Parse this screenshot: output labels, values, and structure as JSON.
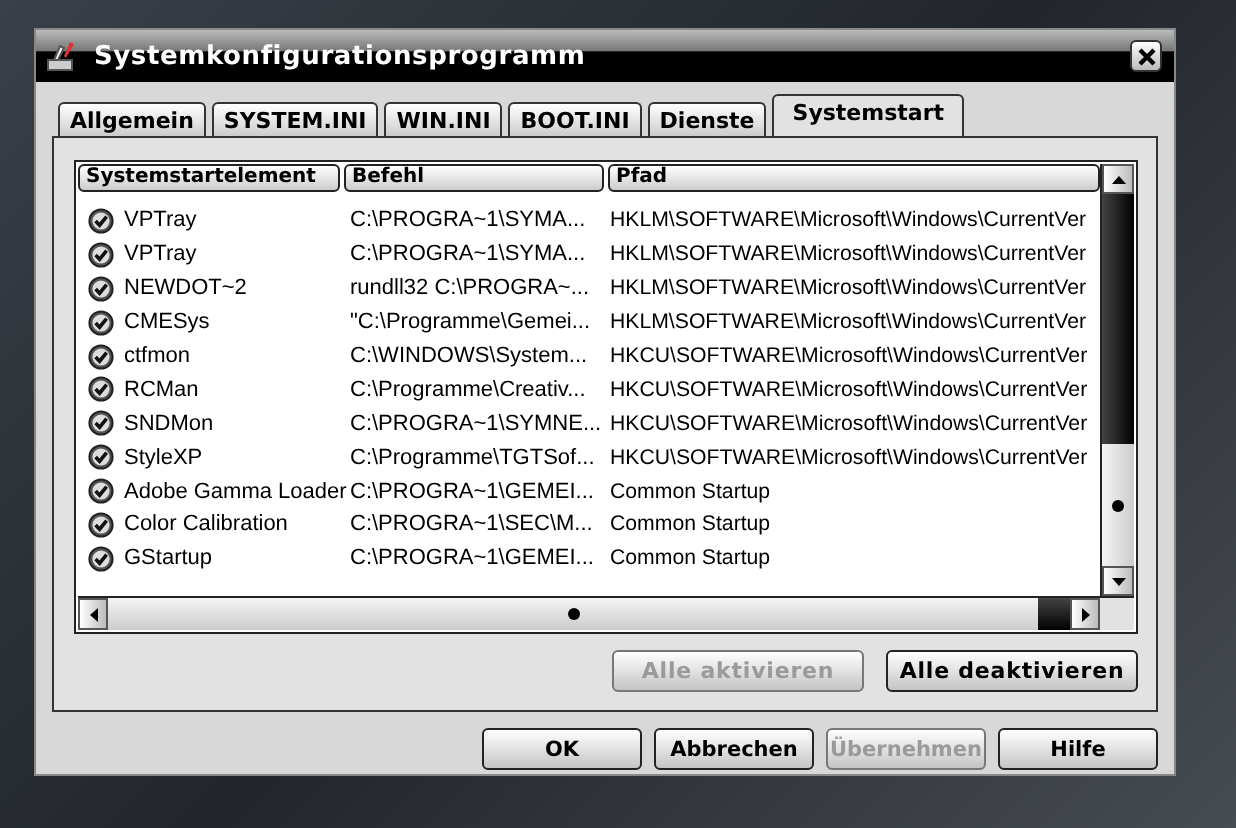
{
  "window": {
    "title": "Systemkonfigurationsprogramm"
  },
  "tabs": [
    {
      "label": "Allgemein",
      "selected": false
    },
    {
      "label": "SYSTEM.INI",
      "selected": false
    },
    {
      "label": "WIN.INI",
      "selected": false
    },
    {
      "label": "BOOT.INI",
      "selected": false
    },
    {
      "label": "Dienste",
      "selected": false
    },
    {
      "label": "Systemstart",
      "selected": true
    }
  ],
  "table": {
    "columns": [
      "Systemstartelement",
      "Befehl",
      "Pfad"
    ],
    "rows": [
      {
        "checked": true,
        "cells": [
          "VPTray",
          "C:\\PROGRA~1\\SYMA...",
          "HKLM\\SOFTWARE\\Microsoft\\Windows\\CurrentVer"
        ]
      },
      {
        "checked": true,
        "cells": [
          "VPTray",
          "C:\\PROGRA~1\\SYMA...",
          "HKLM\\SOFTWARE\\Microsoft\\Windows\\CurrentVer"
        ]
      },
      {
        "checked": true,
        "cells": [
          "NEWDOT~2",
          "rundll32 C:\\PROGRA~...",
          "HKLM\\SOFTWARE\\Microsoft\\Windows\\CurrentVer"
        ]
      },
      {
        "checked": true,
        "cells": [
          "CMESys",
          "\"C:\\Programme\\Gemei...",
          "HKLM\\SOFTWARE\\Microsoft\\Windows\\CurrentVer"
        ]
      },
      {
        "checked": true,
        "cells": [
          "ctfmon",
          "C:\\WINDOWS\\System...",
          "HKCU\\SOFTWARE\\Microsoft\\Windows\\CurrentVer"
        ]
      },
      {
        "checked": true,
        "cells": [
          "RCMan",
          "C:\\Programme\\Creativ...",
          "HKCU\\SOFTWARE\\Microsoft\\Windows\\CurrentVer"
        ]
      },
      {
        "checked": true,
        "cells": [
          "SNDMon",
          "C:\\PROGRA~1\\SYMNE...",
          "HKCU\\SOFTWARE\\Microsoft\\Windows\\CurrentVer"
        ]
      },
      {
        "checked": true,
        "cells": [
          "StyleXP",
          "C:\\Programme\\TGTSof...",
          "HKCU\\SOFTWARE\\Microsoft\\Windows\\CurrentVer"
        ]
      },
      {
        "checked": true,
        "cells": [
          "Adobe Gamma Loader",
          "C:\\PROGRA~1\\GEMEI...",
          "Common Startup"
        ]
      },
      {
        "checked": true,
        "cells": [
          "Color Calibration",
          "C:\\PROGRA~1\\SEC\\M...",
          "Common Startup"
        ]
      },
      {
        "checked": true,
        "cells": [
          "GStartup",
          "C:\\PROGRA~1\\GEMEI...",
          "Common Startup"
        ]
      }
    ]
  },
  "list_buttons": [
    {
      "label": "Alle aktivieren",
      "disabled": true
    },
    {
      "label": "Alle deaktivieren",
      "disabled": false
    }
  ],
  "dialog_buttons": [
    {
      "label": "OK",
      "disabled": false
    },
    {
      "label": "Abbrechen",
      "disabled": false
    },
    {
      "label": "Übernehmen",
      "disabled": true
    },
    {
      "label": "Hilfe",
      "disabled": false
    }
  ]
}
